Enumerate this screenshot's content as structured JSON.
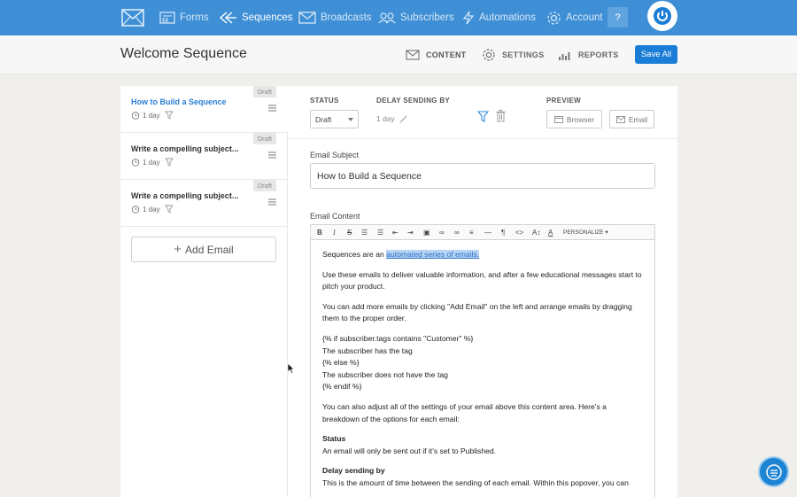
{
  "nav": {
    "items": [
      {
        "label": "Forms",
        "icon": "forms-icon"
      },
      {
        "label": "Sequences",
        "icon": "sequences-icon"
      },
      {
        "label": "Broadcasts",
        "icon": "broadcasts-icon"
      },
      {
        "label": "Subscribers",
        "icon": "subscribers-icon"
      },
      {
        "label": "Automations",
        "icon": "automations-icon"
      },
      {
        "label": "Account",
        "icon": "gear-icon"
      }
    ],
    "help_label": "?",
    "brand_color": "#3e8fd6"
  },
  "header": {
    "title": "Welcome Sequence",
    "tabs": [
      {
        "label": "CONTENT"
      },
      {
        "label": "SETTINGS"
      },
      {
        "label": "REPORTS"
      }
    ],
    "save_label": "Save All"
  },
  "emails": [
    {
      "title": "How to Build a Sequence",
      "badge": "Draft",
      "delay": "1 day",
      "active": true
    },
    {
      "title": "Write a compelling subject...",
      "badge": "Draft",
      "delay": "1 day",
      "active": false
    },
    {
      "title": "Write a compelling subject...",
      "badge": "Draft",
      "delay": "1 day",
      "active": false
    }
  ],
  "add_email_label": "Add Email",
  "settings": {
    "status_label": "STATUS",
    "status_value": "Draft",
    "delay_label": "DELAY SENDING BY",
    "delay_value": "1 day",
    "preview_label": "PREVIEW",
    "preview_browser": "Browser",
    "preview_email": "Email"
  },
  "subject": {
    "label": "Email Subject",
    "value": "How to Build a Sequence"
  },
  "content": {
    "label": "Email Content",
    "personalize_label": "PERSONALIZE",
    "p1_pre": "Sequences are an ",
    "p1_link": "automated series of emails.",
    "p2": "Use these emails to deliver valuable information, and after a few educational messages start to pitch your product.",
    "p3": "You can add more emails by clicking \"Add Email\" on the left and arrange emails by dragging them to the proper order.",
    "liquid": [
      "{% if subscriber.tags contains \"Customer\" %}",
      "The subscriber has the tag",
      "{% else %}",
      "The subscriber does not have the tag",
      "{% endif %}"
    ],
    "p4": "You can also adjust all of the settings of your email above this content area. Here's a breakdown of the options for each email:",
    "status_heading": "Status",
    "status_text": "An email will only be sent out if it's set to Published.",
    "delay_heading": "Delay sending by",
    "delay_text": "This is the amount of time between the sending of each email. Within this popover, you can"
  }
}
